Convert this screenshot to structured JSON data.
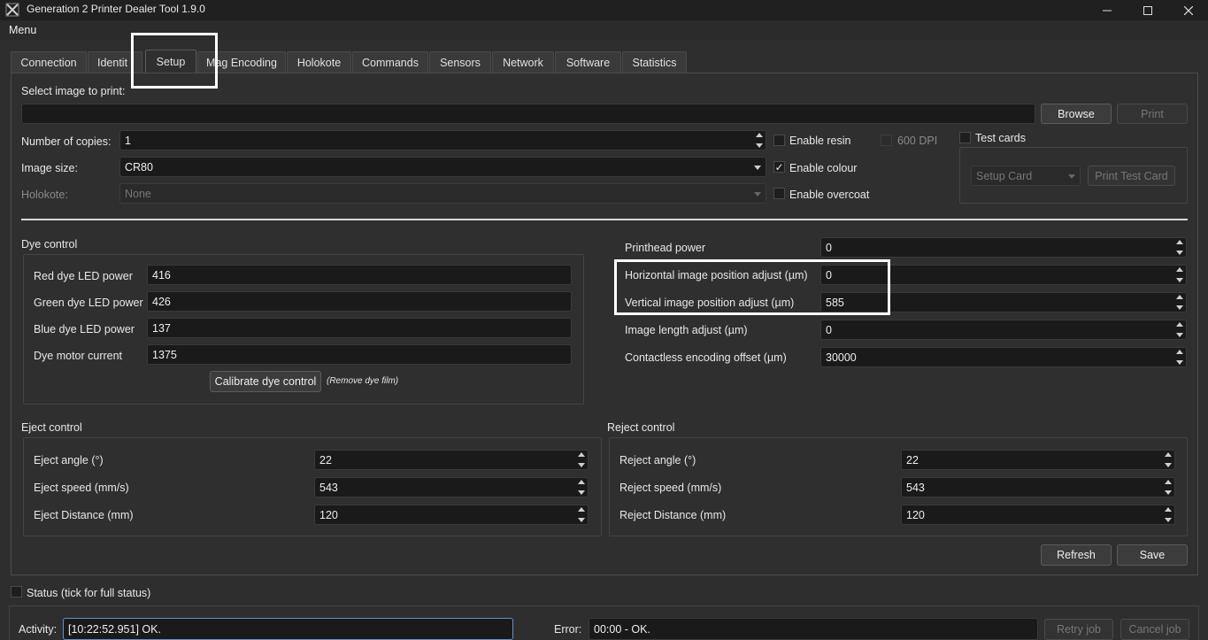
{
  "window": {
    "title": "Generation 2 Printer Dealer Tool 1.9.0"
  },
  "menu": {
    "label": "Menu"
  },
  "tabs": [
    "Connection",
    "Identity",
    "Setup",
    "Mag Encoding",
    "Holokote",
    "Commands",
    "Sensors",
    "Network",
    "Software",
    "Statistics"
  ],
  "tab_identity_visible": "Identit",
  "setup": {
    "select_image_label": "Select image to print:",
    "image_path": "",
    "browse_label": "Browse",
    "print_label": "Print",
    "copies_label": "Number of copies:",
    "copies_value": "1",
    "image_size_label": "Image size:",
    "image_size_value": "CR80",
    "holokote_label": "Holokote:",
    "holokote_value": "None",
    "enable_resin_label": "Enable resin",
    "enable_resin_checked": false,
    "dpi_label": "600 DPI",
    "enable_colour_label": "Enable colour",
    "enable_colour_checked": true,
    "enable_colour_mark": "✓",
    "enable_overcoat_label": "Enable overcoat",
    "test_cards_label": "Test cards",
    "setup_card_value": "Setup Card",
    "print_test_card_label": "Print Test Card"
  },
  "dye": {
    "title": "Dye control",
    "rows": [
      {
        "label": "Red dye LED power",
        "value": "416"
      },
      {
        "label": "Green dye LED power",
        "value": "426"
      },
      {
        "label": "Blue dye LED power",
        "value": "137"
      },
      {
        "label": "Dye motor current",
        "value": "1375"
      }
    ],
    "calibrate_label": "Calibrate dye control",
    "calibrate_note": "(Remove dye film)"
  },
  "printhead": {
    "rows": [
      {
        "label": "Printhead power",
        "value": "0"
      },
      {
        "label": "Horizontal image position adjust (µm)",
        "value": "0"
      },
      {
        "label": "Vertical image position adjust (µm)",
        "value": "585"
      },
      {
        "label": "Image length adjust (µm)",
        "value": "0"
      },
      {
        "label": "Contactless encoding offset (µm)",
        "value": "30000"
      }
    ]
  },
  "eject": {
    "title": "Eject control",
    "rows": [
      {
        "label": "Eject angle (°)",
        "value": "22"
      },
      {
        "label": "Eject speed (mm/s)",
        "value": "543"
      },
      {
        "label": "Eject Distance (mm)",
        "value": "120"
      }
    ]
  },
  "reject": {
    "title": "Reject control",
    "rows": [
      {
        "label": "Reject angle (°)",
        "value": "22"
      },
      {
        "label": "Reject speed (mm/s)",
        "value": "543"
      },
      {
        "label": "Reject Distance (mm)",
        "value": "120"
      }
    ]
  },
  "actions": {
    "refresh_label": "Refresh",
    "save_label": "Save"
  },
  "status": {
    "label": "Status (tick for full status)",
    "activity_label": "Activity:",
    "activity_value": "[10:22:52.951] OK.",
    "error_label": "Error:",
    "error_value": "00:00 - OK.",
    "retry_label": "Retry job",
    "cancel_label": "Cancel job"
  },
  "colors": {
    "background": "#2e2e2e",
    "field": "#1a1a1a",
    "highlight": "#ffffff"
  }
}
